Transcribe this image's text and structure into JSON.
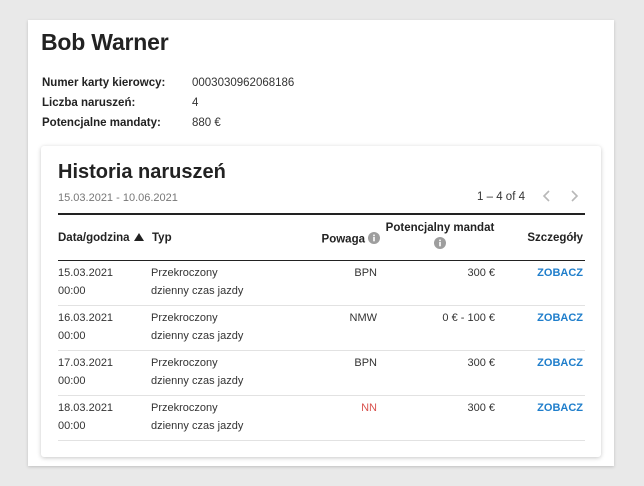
{
  "driver": {
    "name": "Bob Warner",
    "fields": [
      {
        "label": "Numer karty kierowcy:",
        "value": "0003030962068186"
      },
      {
        "label": "Liczba naruszeń:",
        "value": "4"
      },
      {
        "label": "Potencjalne mandaty:",
        "value": "880 €"
      }
    ]
  },
  "history": {
    "title": "Historia naruszeń",
    "date_range": "15.03.2021 - 10.06.2021",
    "pagination": {
      "label": "1 – 4 of 4",
      "prev_icon": "chevron-left-icon",
      "next_icon": "chevron-right-icon"
    },
    "columns": {
      "date": "Data/godzina",
      "type": "Typ",
      "severity": "Powaga",
      "ticket": "Potencjalny mandat",
      "details": "Szczegóły"
    },
    "rows": [
      {
        "date": "15.03.2021",
        "time": "00:00",
        "type_line1": "Przekroczony",
        "type_line2": "dzienny czas jazdy",
        "severity": "BPN",
        "ticket": "300 €",
        "details": "ZOBACZ"
      },
      {
        "date": "16.03.2021",
        "time": "00:00",
        "type_line1": "Przekroczony",
        "type_line2": "dzienny czas jazdy",
        "severity": "NMW",
        "ticket": "0 € - 100 €",
        "details": "ZOBACZ"
      },
      {
        "date": "17.03.2021",
        "time": "00:00",
        "type_line1": "Przekroczony",
        "type_line2": "dzienny czas jazdy",
        "severity": "BPN",
        "ticket": "300 €",
        "details": "ZOBACZ"
      },
      {
        "date": "18.03.2021",
        "time": "00:00",
        "type_line1": "Przekroczony",
        "type_line2": "dzienny czas jazdy",
        "severity": "NN",
        "ticket": "300 €",
        "details": "ZOBACZ"
      }
    ]
  },
  "colors": {
    "link": "#1f7ecb",
    "severity_nn": "#d9534f",
    "background": "#e9e9e9"
  }
}
